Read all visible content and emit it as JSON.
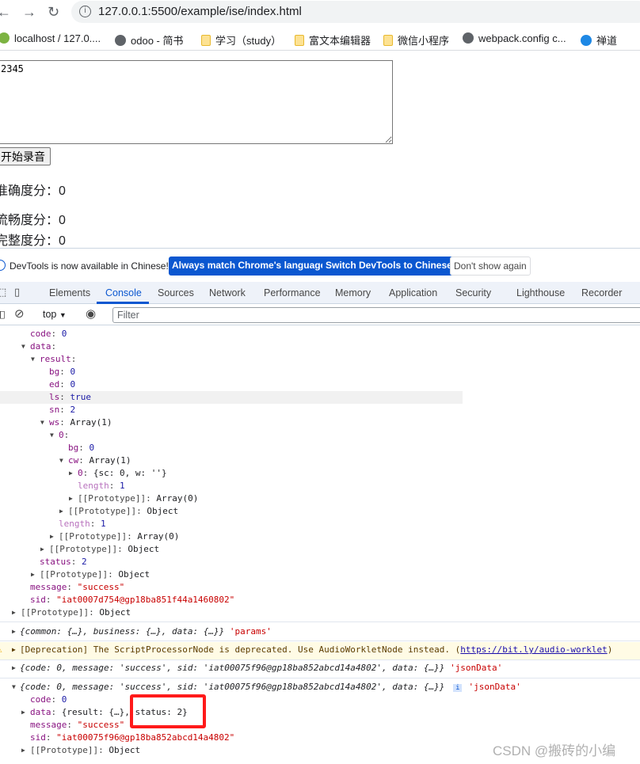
{
  "browser": {
    "url": "127.0.0.1:5500/example/ise/index.html",
    "bookmarks": [
      {
        "label": "localhost / 127.0....",
        "icon": "g"
      },
      {
        "label": "odoo - 简书",
        "icon": "globe"
      },
      {
        "label": "学习（study）",
        "icon": "folder"
      },
      {
        "label": "富文本编辑器",
        "icon": "folder"
      },
      {
        "label": "微信小程序",
        "icon": "folder"
      },
      {
        "label": "webpack.config c...",
        "icon": "globe"
      },
      {
        "label": "禅道",
        "icon": "z"
      }
    ]
  },
  "page": {
    "textarea_value": "2345",
    "record_button": "开始录音",
    "scores": [
      {
        "label": "准确度分：",
        "value": "0"
      },
      {
        "label": "流畅度分：",
        "value": "0"
      },
      {
        "label": "完整度分：",
        "value": "0"
      }
    ]
  },
  "devtools": {
    "infobar": {
      "message": "DevTools is now available in Chinese!",
      "btn_match": "Always match Chrome's language",
      "btn_switch": "Switch DevTools to Chinese",
      "btn_dismiss": "Don't show again"
    },
    "tabs": [
      "Elements",
      "Console",
      "Sources",
      "Network",
      "Performance",
      "Memory",
      "Application",
      "Security",
      "Lighthouse",
      "Recorder"
    ],
    "active_tab": "Console",
    "context": "top",
    "filter_placeholder": "Filter",
    "tree": [
      {
        "lvl": 1,
        "k": "code",
        "v": "0",
        "vt": "n"
      },
      {
        "lvl": 1,
        "a": "down",
        "k": "data",
        "v": ""
      },
      {
        "lvl": 2,
        "a": "down",
        "k": "result",
        "v": ""
      },
      {
        "lvl": 3,
        "k": "bg",
        "v": "0",
        "vt": "n"
      },
      {
        "lvl": 3,
        "k": "ed",
        "v": "0",
        "vt": "n"
      },
      {
        "lvl": 3,
        "k": "ls",
        "v": "true",
        "vt": "n",
        "hl": true
      },
      {
        "lvl": 3,
        "k": "sn",
        "v": "2",
        "vt": "n"
      },
      {
        "lvl": 3,
        "a": "down",
        "k": "ws",
        "v": "Array(1)",
        "vt": "o"
      },
      {
        "lvl": 4,
        "a": "down",
        "k": "0",
        "v": ""
      },
      {
        "lvl": 5,
        "k": "bg",
        "v": "0",
        "vt": "n"
      },
      {
        "lvl": 5,
        "a": "down",
        "k": "cw",
        "v": "Array(1)",
        "vt": "o"
      },
      {
        "lvl": 6,
        "a": "right",
        "k": "0",
        "v": "{sc: 0, w: ''}",
        "vt": "o"
      },
      {
        "lvl": 6,
        "k": "length",
        "v": "1",
        "vt": "n",
        "kt": "len"
      },
      {
        "lvl": 6,
        "a": "right",
        "k": "[[Prototype]]",
        "v": "Array(0)",
        "vt": "o",
        "kt": "proto"
      },
      {
        "lvl": 5,
        "a": "right",
        "k": "[[Prototype]]",
        "v": "Object",
        "vt": "o",
        "kt": "proto"
      },
      {
        "lvl": 4,
        "k": "length",
        "v": "1",
        "vt": "n",
        "kt": "len"
      },
      {
        "lvl": 4,
        "a": "right",
        "k": "[[Prototype]]",
        "v": "Array(0)",
        "vt": "o",
        "kt": "proto"
      },
      {
        "lvl": 3,
        "a": "right",
        "k": "[[Prototype]]",
        "v": "Object",
        "vt": "o",
        "kt": "proto"
      },
      {
        "lvl": 2,
        "k": "status",
        "v": "2",
        "vt": "n"
      },
      {
        "lvl": 2,
        "a": "right",
        "k": "[[Prototype]]",
        "v": "Object",
        "vt": "o",
        "kt": "proto"
      },
      {
        "lvl": 1,
        "k": "message",
        "v": "\"success\"",
        "vt": "s"
      },
      {
        "lvl": 1,
        "k": "sid",
        "v": "\"iat0007d754@gp18ba851f44a1460802\"",
        "vt": "s"
      },
      {
        "lvl": 0,
        "a": "right",
        "k": "[[Prototype]]",
        "v": "Object",
        "vt": "o",
        "kt": "proto"
      }
    ],
    "messages": {
      "params": {
        "obj": "{common: {…}, business: {…}, data: {…}}",
        "label": "'params'"
      },
      "deprecation": {
        "text": "[Deprecation] The ScriptProcessorNode is deprecated. Use AudioWorkletNode instead. (",
        "link": "https://bit.ly/audio-worklet",
        "close": ")"
      },
      "json1": {
        "obj": "{code: 0, message: 'success', sid: 'iat00075f96@gp18ba852abcd14a4802', data: {…}}",
        "label": "'jsonData'"
      },
      "json2": {
        "obj": "{code: 0, message: 'success', sid: 'iat00075f96@gp18ba852abcd14a4802', data: {…}}",
        "label": "'jsonData'",
        "info": "i"
      },
      "tree2": [
        {
          "lvl": 1,
          "k": "code",
          "v": "0",
          "vt": "n"
        },
        {
          "lvl": 1,
          "a": "right",
          "k": "data",
          "v": "{result: {…}, status: 2}",
          "vt": "o"
        },
        {
          "lvl": 1,
          "k": "message",
          "v": "\"success\"",
          "vt": "s"
        },
        {
          "lvl": 1,
          "k": "sid",
          "v": "\"iat00075f96@gp18ba852abcd14a4802\"",
          "vt": "s"
        },
        {
          "lvl": 1,
          "a": "right",
          "k": "[[Prototype]]",
          "v": "Object",
          "vt": "o",
          "kt": "proto"
        }
      ]
    }
  },
  "watermark": "CSDN @搬砖的小编"
}
